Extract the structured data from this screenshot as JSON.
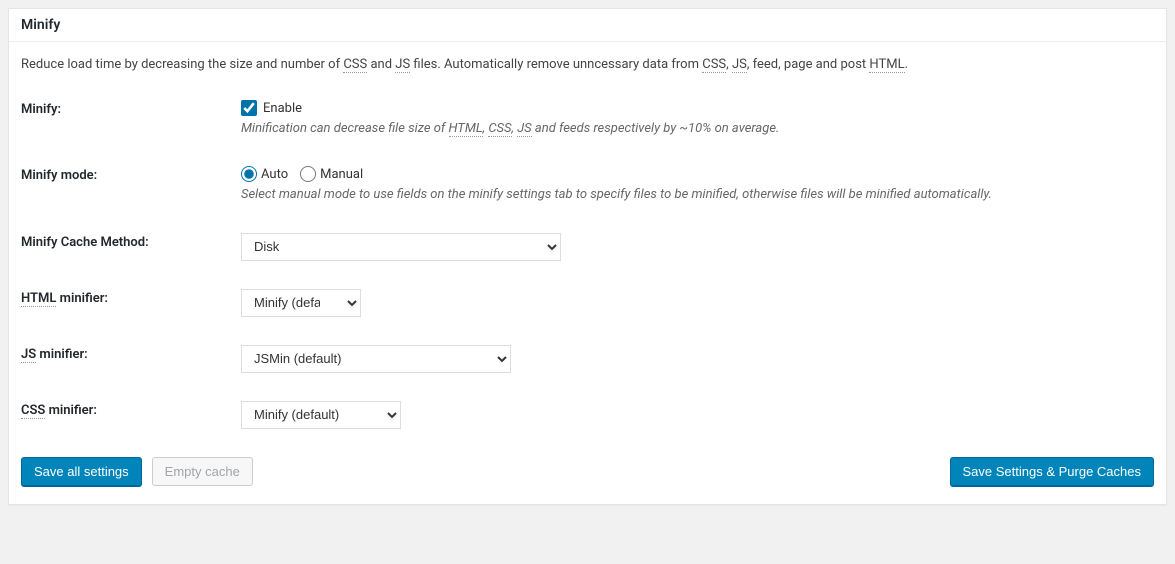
{
  "panel": {
    "title": "Minify",
    "intro_pre": "Reduce load time by decreasing the size and number of ",
    "intro_css": "CSS",
    "intro_and": " and ",
    "intro_js": "JS",
    "intro_mid": " files. Automatically remove unncessary data from ",
    "intro_css2": "CSS",
    "intro_comma": ", ",
    "intro_js2": "JS",
    "intro_tail": ", feed, page and post ",
    "intro_html": "HTML",
    "intro_end": "."
  },
  "minify": {
    "label": "Minify:",
    "enable": "Enable",
    "checked": true,
    "hint_pre": "Minification can decrease file size of ",
    "hint_html": "HTML",
    "hint_c1": ", ",
    "hint_css": "CSS",
    "hint_c2": ", ",
    "hint_js": "JS",
    "hint_tail": " and feeds respectively by ~10% on average."
  },
  "mode": {
    "label": "Minify mode:",
    "auto": "Auto",
    "manual": "Manual",
    "selected": "auto",
    "hint": "Select manual mode to use fields on the minify settings tab to specify files to be minified, otherwise files will be minified automatically."
  },
  "cache_method": {
    "label": "Minify Cache Method:",
    "value": "Disk"
  },
  "html_minifier": {
    "label_abbr": "HTML",
    "label_rest": " minifier:",
    "value": "Minify (default)"
  },
  "js_minifier": {
    "label_abbr": "JS",
    "label_rest": " minifier:",
    "value": "JSMin (default)"
  },
  "css_minifier": {
    "label_abbr": "CSS",
    "label_rest": " minifier:",
    "value": "Minify (default)"
  },
  "buttons": {
    "save_all": "Save all settings",
    "empty_cache": "Empty cache",
    "save_purge": "Save Settings & Purge Caches"
  }
}
